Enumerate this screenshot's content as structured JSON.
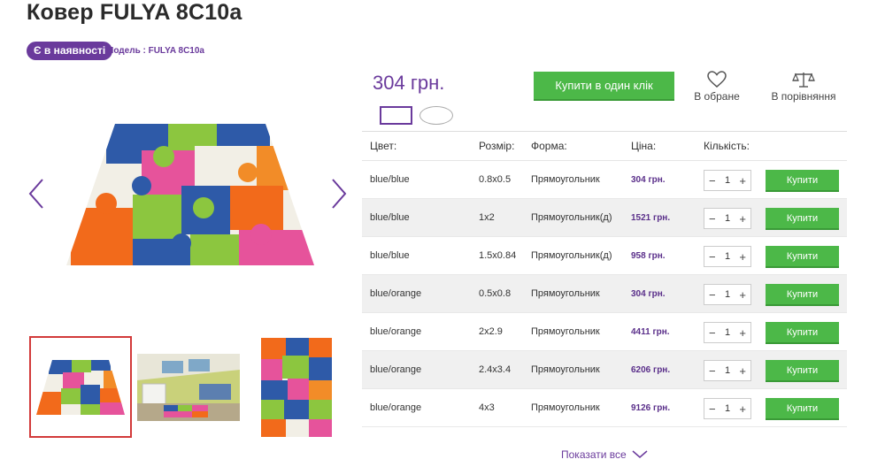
{
  "product": {
    "title": "Ковер FULYA 8C10a",
    "stock_badge": "Є в наявності",
    "model_label": "Модель : FULYA 8C10a",
    "price": "304 грн."
  },
  "actions": {
    "buy_one_click": "Купити в один клік",
    "favorites": "В обране",
    "compare": "В порівняння"
  },
  "table": {
    "headers": {
      "color": "Цвет:",
      "size": "Розмір:",
      "shape": "Форма:",
      "price": "Ціна:",
      "qty": "Кількість:"
    },
    "rows": [
      {
        "color": "blue/blue",
        "size": "0.8x0.5",
        "shape": "Прямоугольник",
        "price": "304 грн.",
        "qty": "1",
        "buy": "Купити"
      },
      {
        "color": "blue/blue",
        "size": "1x2",
        "shape": "Прямоугольник(д)",
        "price": "1521 грн.",
        "qty": "1",
        "buy": "Купити"
      },
      {
        "color": "blue/blue",
        "size": "1.5x0.84",
        "shape": "Прямоугольник(д)",
        "price": "958 грн.",
        "qty": "1",
        "buy": "Купити"
      },
      {
        "color": "blue/orange",
        "size": "0.5x0.8",
        "shape": "Прямоугольник",
        "price": "304 грн.",
        "qty": "1",
        "buy": "Купити"
      },
      {
        "color": "blue/orange",
        "size": "2x2.9",
        "shape": "Прямоугольник",
        "price": "4411 грн.",
        "qty": "1",
        "buy": "Купити"
      },
      {
        "color": "blue/orange",
        "size": "2.4x3.4",
        "shape": "Прямоугольник",
        "price": "6206 грн.",
        "qty": "1",
        "buy": "Купити"
      },
      {
        "color": "blue/orange",
        "size": "4x3",
        "shape": "Прямоугольник",
        "price": "9126 грн.",
        "qty": "1",
        "buy": "Купити"
      }
    ],
    "minus": "−",
    "plus": "+"
  },
  "show_all": "Показати все",
  "icons": {
    "prev": "chevron-left-icon",
    "next": "chevron-right-icon",
    "favorite": "heart-icon",
    "compare": "scales-icon",
    "show_all": "chevron-down-icon"
  },
  "colors": {
    "brand": "#6a3a9c",
    "buy_green": "#4cb848",
    "thumb_active": "#d23a3a"
  }
}
